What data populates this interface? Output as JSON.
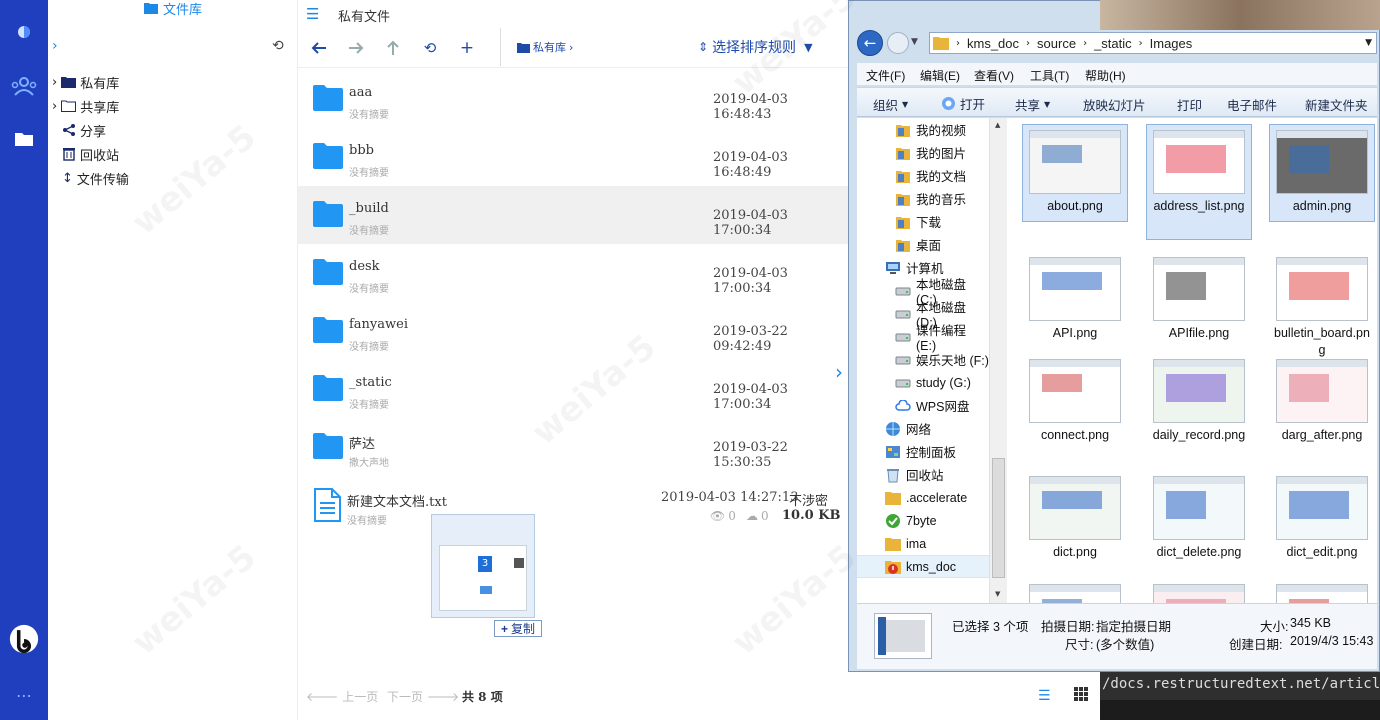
{
  "watermark": "weiYa-5",
  "sidebar": {
    "title": "文件库",
    "items": [
      {
        "label": "私有库"
      },
      {
        "label": "共享库"
      },
      {
        "label": "分享"
      },
      {
        "label": "回收站"
      },
      {
        "label": "文件传输"
      }
    ]
  },
  "list": {
    "header_title": "私有文件",
    "breadcrumb": "私有库",
    "sort_label": "选择排序规则",
    "files": [
      {
        "name": "aaa",
        "summary": "没有摘要",
        "date": "2019-04-03 16:48:43"
      },
      {
        "name": "bbb",
        "summary": "没有摘要",
        "date": "2019-04-03 16:48:49"
      },
      {
        "name": "_build",
        "summary": "没有摘要",
        "date": "2019-04-03 17:00:34"
      },
      {
        "name": "desk",
        "summary": "没有摘要",
        "date": "2019-04-03 17:00:34"
      },
      {
        "name": "fanyawei",
        "summary": "没有摘要",
        "date": "2019-03-22 09:42:49"
      },
      {
        "name": "_static",
        "summary": "没有摘要",
        "date": "2019-04-03 17:00:34"
      },
      {
        "name": "萨达",
        "summary": "撒大声地",
        "date": "2019-03-22 15:30:35"
      }
    ],
    "doc": {
      "name": "新建文本文档.txt",
      "summary": "没有摘要",
      "date": "2019-04-03 14:27:13",
      "level": "不涉密",
      "views": "0",
      "downloads": "0",
      "size": "10.0 KB"
    },
    "drag": {
      "badge": "3",
      "action": "复制"
    },
    "pager": {
      "prev": "上一页",
      "next": "下一页",
      "total": "共 8 项"
    }
  },
  "explorer": {
    "path": [
      "kms_doc",
      "source",
      "_static",
      "Images"
    ],
    "menu": [
      "文件(F)",
      "编辑(E)",
      "查看(V)",
      "工具(T)",
      "帮助(H)"
    ],
    "commands": [
      "组织",
      "打开",
      "共享",
      "放映幻灯片",
      "打印",
      "电子邮件",
      "新建文件夹"
    ],
    "nav": [
      {
        "label": "我的视频",
        "icon": "folder-lib"
      },
      {
        "label": "我的图片",
        "icon": "folder-lib"
      },
      {
        "label": "我的文档",
        "icon": "folder-lib"
      },
      {
        "label": "我的音乐",
        "icon": "folder-lib"
      },
      {
        "label": "下载",
        "icon": "folder-lib"
      },
      {
        "label": "桌面",
        "icon": "folder-lib"
      },
      {
        "label": "计算机",
        "icon": "computer"
      },
      {
        "label": "本地磁盘 (C:)",
        "icon": "drive"
      },
      {
        "label": "本地磁盘 (D:)",
        "icon": "drive"
      },
      {
        "label": "课件编程 (E:)",
        "icon": "drive"
      },
      {
        "label": "娱乐天地 (F:)",
        "icon": "drive"
      },
      {
        "label": "study (G:)",
        "icon": "drive"
      },
      {
        "label": "WPS网盘",
        "icon": "cloud"
      },
      {
        "label": "网络",
        "icon": "network"
      },
      {
        "label": "控制面板",
        "icon": "control"
      },
      {
        "label": "回收站",
        "icon": "recycle"
      },
      {
        "label": ".accelerate",
        "icon": "folder"
      },
      {
        "label": "7byte",
        "icon": "check"
      },
      {
        "label": "ima",
        "icon": "folder"
      },
      {
        "label": "kms_doc",
        "icon": "warn"
      }
    ],
    "files": [
      {
        "name": "about.png"
      },
      {
        "name": "address_list.png"
      },
      {
        "name": "admin.png"
      },
      {
        "name": "API.png"
      },
      {
        "name": "APIfile.png"
      },
      {
        "name": "bulletin_board.png"
      },
      {
        "name": "connect.png"
      },
      {
        "name": "daily_record.png"
      },
      {
        "name": "darg_after.png"
      },
      {
        "name": "dict.png"
      },
      {
        "name": "dict_delete.png"
      },
      {
        "name": "dict_edit.png"
      },
      {
        "name": ""
      },
      {
        "name": ""
      },
      {
        "name": ""
      }
    ],
    "details": {
      "selected": "已选择 3 个项",
      "shot_label": "拍摄日期:",
      "shot_value": "指定拍摄日期",
      "dim_label": "尺寸:",
      "dim_value": "(多个数值)",
      "size_label": "大小:",
      "size_value": "345 KB",
      "created_label": "创建日期:",
      "created_value": "2019/4/3 15:43"
    }
  },
  "terminal": {
    "text": "/docs.restructuredtext.net/article"
  }
}
